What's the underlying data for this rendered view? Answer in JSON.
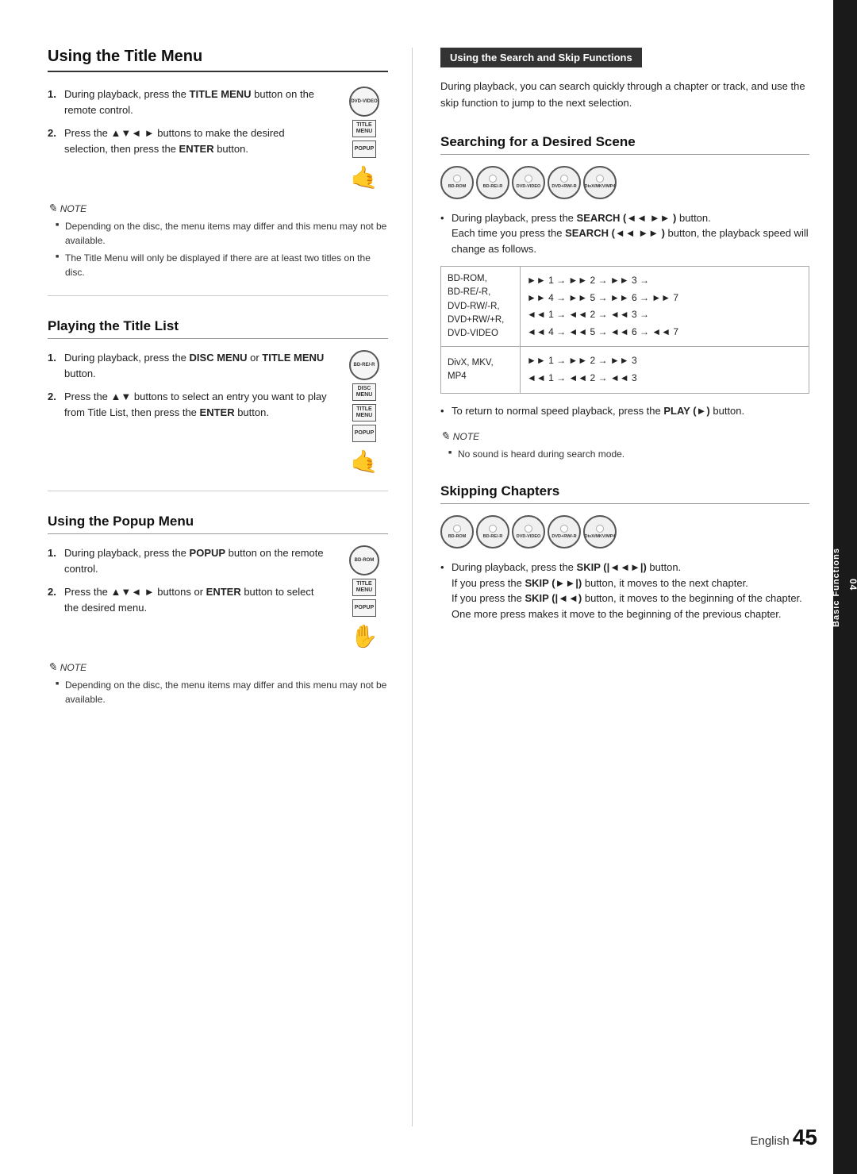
{
  "page": {
    "number": "45",
    "language": "English",
    "chapter": "04",
    "chapter_title": "Basic Functions"
  },
  "left": {
    "section1": {
      "title": "Using the Title Menu",
      "steps": [
        {
          "num": "1.",
          "text_before": "During playback, press the ",
          "bold1": "TITLE MENU",
          "text_after": " button on the remote control."
        },
        {
          "num": "2.",
          "text_before": "Press the ▲▼◄ ► buttons to make the desired selection, then press the ",
          "bold1": "ENTER",
          "text_after": " button."
        }
      ],
      "note_label": "NOTE",
      "notes": [
        "Depending on the disc, the menu items may differ and this menu may not be available.",
        "The Title Menu will only be displayed if there are at least two titles on the disc."
      ],
      "icon1_label": "DVD-VIDEO",
      "icon2_label": "TITLE MENU",
      "icon3_label": "POPUP"
    },
    "section2": {
      "title": "Playing the Title List",
      "steps": [
        {
          "num": "1.",
          "text_before": "During playback, press the ",
          "bold1": "DISC MENU",
          "text_mid": " or ",
          "bold2": "TITLE MENU",
          "text_after": " button."
        },
        {
          "num": "2.",
          "text_before": "Press the ▲▼ buttons to select an entry you want to play from Title List, then press the ",
          "bold1": "ENTER",
          "text_after": " button."
        }
      ],
      "icon1_label": "BD-RE/-R",
      "icon2_label": "DISC MENU",
      "icon3_label": "TITLE MENU",
      "icon4_label": "POPUP"
    },
    "section3": {
      "title": "Using the Popup Menu",
      "steps": [
        {
          "num": "1.",
          "text_before": "During playback, press the ",
          "bold1": "POPUP",
          "text_after": " button on the remote control."
        },
        {
          "num": "2.",
          "text_before": "Press the ▲▼◄ ► buttons or ",
          "bold1": "ENTER",
          "text_after": " button to select the desired menu."
        }
      ],
      "note_label": "NOTE",
      "notes": [
        "Depending on the disc, the menu items may differ and this menu may not be available."
      ],
      "icon1_label": "BD-ROM",
      "icon2_label": "TITLE MENU",
      "icon3_label": "POPUP"
    }
  },
  "right": {
    "header": "Using the Search and Skip Functions",
    "intro": "During playback, you can search quickly through a chapter or track, and use the skip function to jump to the next selection.",
    "section1": {
      "title": "Searching for a Desired Scene",
      "disc_icons": [
        "BD-ROM",
        "BD-RE/-R",
        "DVD-VIDEO",
        "DVD+RW/-R",
        "DivX/MKV/MP4"
      ],
      "bullet1_before": "During playback, press the ",
      "bullet1_bold": "SEARCH (◄◄ ►► )",
      "bullet1_after": " button.",
      "bullet2_before": "Each time you press the ",
      "bullet2_bold": "SEARCH (◄◄ ►► )",
      "bullet2_after": " button, the playback speed will change as follows.",
      "table": {
        "rows": [
          {
            "label": "BD-ROM,\nBD-RE/-R,\nDVD-RW/-R,\nDVD+RW/+R,\nDVD-VIDEO",
            "value": "►► 1 → ►► 2 → ►► 3 →\n►► 4 → ►► 5 → ►► 6 → ►► 7\n◄◄ 1 → ◄◄ 2 → ◄◄ 3 →\n◄◄ 4 → ◄◄ 5 → ◄◄ 6 → ◄◄ 7"
          },
          {
            "label": "DivX, MKV, MP4",
            "value": "►► 1 → ►► 2 → ►► 3\n◄◄ 1 → ◄◄ 2 → ◄◄ 3"
          }
        ]
      },
      "return_text_before": "To return to normal speed playback, press the ",
      "return_bold": "PLAY (►)",
      "return_text_after": " button.",
      "note_label": "NOTE",
      "notes": [
        "No sound is heard during search mode."
      ]
    },
    "section2": {
      "title": "Skipping Chapters",
      "disc_icons": [
        "BD-ROM",
        "BD-RE/-R",
        "DVD-VIDEO",
        "DVD+RW/-R",
        "DivX/MKV/MP4"
      ],
      "bullet1_before": "During playback, press the ",
      "bullet1_bold": "SKIP (|◄◄►|)",
      "bullet1_after": " button.",
      "skip_next_before": "If you press the ",
      "skip_next_bold": "SKIP (►►|)",
      "skip_next_after": " button, it moves to the next chapter.",
      "skip_prev_before": "If you press the ",
      "skip_prev_bold": "SKIP (|◄◄)",
      "skip_prev_after": " button, it moves to the beginning of the chapter. One more press makes it move to the beginning of the previous chapter."
    }
  }
}
